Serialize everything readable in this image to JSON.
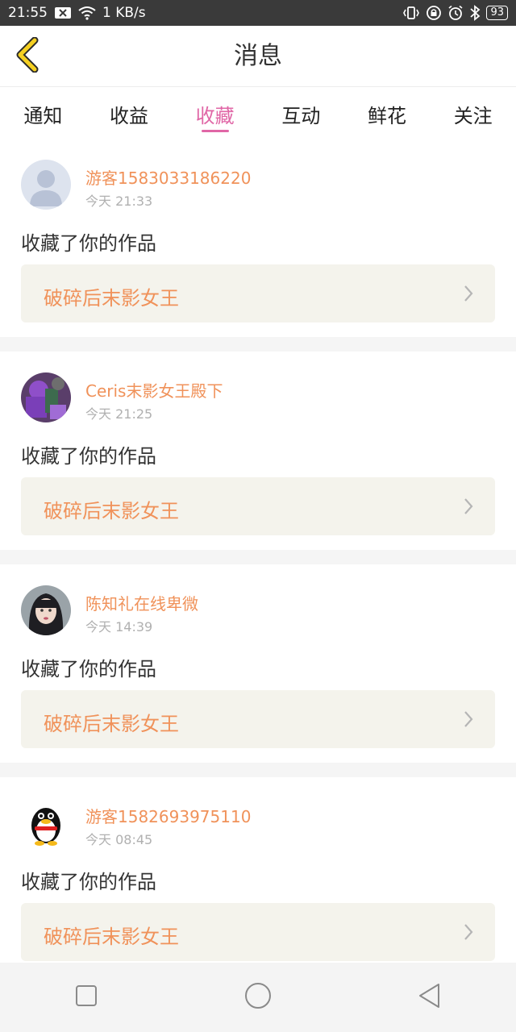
{
  "status_bar": {
    "time": "21:55",
    "network_speed": "1 KB/s",
    "battery": "93",
    "icons": [
      "notification-icon",
      "wifi-icon",
      "vibrate-icon",
      "lock-rotation-icon",
      "alarm-icon",
      "bluetooth-icon",
      "battery-icon"
    ]
  },
  "header": {
    "title": "消息",
    "back_icon": "chevron-left-icon",
    "accent_color": "#f5d021"
  },
  "tabs": [
    {
      "label": "通知",
      "active": false
    },
    {
      "label": "收益",
      "active": false
    },
    {
      "label": "收藏",
      "active": true
    },
    {
      "label": "互动",
      "active": false
    },
    {
      "label": "鲜花",
      "active": false
    },
    {
      "label": "关注",
      "active": false
    }
  ],
  "colors": {
    "active_tab": "#e066a6",
    "username": "#f0925a",
    "work_title": "#f0925a",
    "work_box_bg": "#f4f3ec"
  },
  "messages": [
    {
      "username": "游客1583033186220",
      "time": "今天 21:33",
      "action": "收藏了你的作品",
      "work_title": "破碎后末影女王",
      "avatar": "default-avatar"
    },
    {
      "username": "Ceris末影女王殿下",
      "time": "今天 21:25",
      "action": "收藏了你的作品",
      "work_title": "破碎后末影女王",
      "avatar": "purple-character-avatar"
    },
    {
      "username": "陈知礼在线卑微",
      "time": "今天 14:39",
      "action": "收藏了你的作品",
      "work_title": "破碎后末影女王",
      "avatar": "girl-photo-avatar"
    },
    {
      "username": "游客1582693975110",
      "time": "今天 08:45",
      "action": "收藏了你的作品",
      "work_title": "破碎后末影女王",
      "avatar": "penguin-avatar"
    }
  ],
  "nav_bar": {
    "icons": [
      "recents-square-icon",
      "home-circle-icon",
      "back-triangle-icon"
    ]
  }
}
